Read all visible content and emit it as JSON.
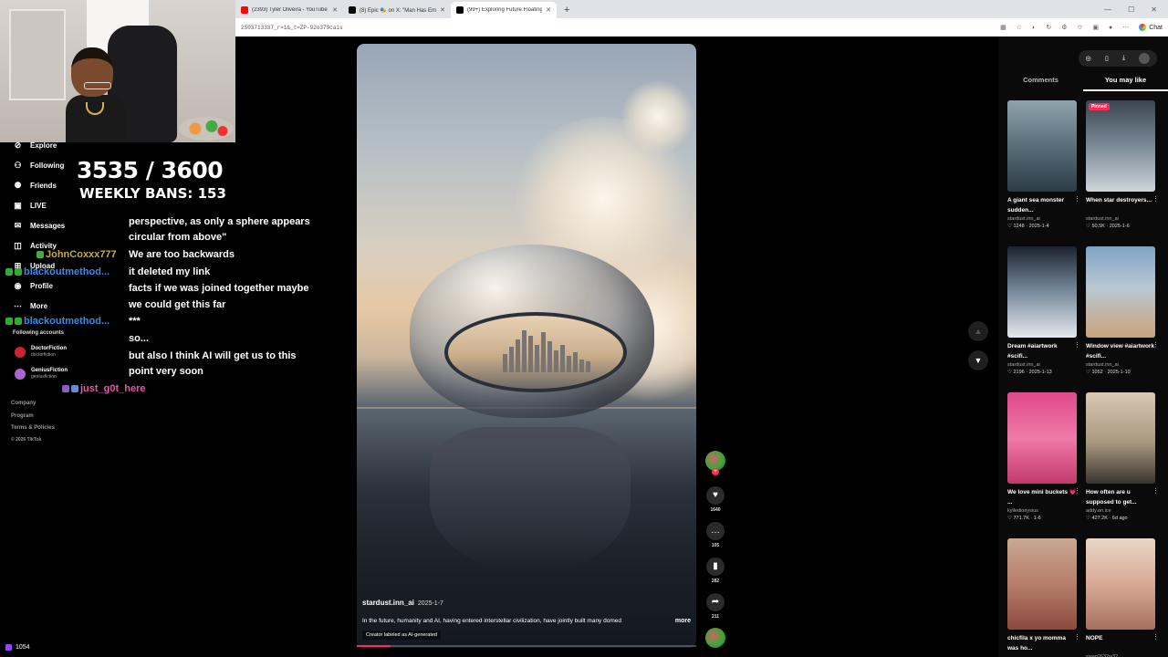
{
  "browser": {
    "tabs": [
      {
        "title": "(2393) Tyler Oliveira - YouTube",
        "icon_color": "#ff0000"
      },
      {
        "title": "(8) Epic 🎭 on X: \"Man Has Emoti...",
        "icon_color": "#000000"
      },
      {
        "title": "(99+) Exploring Future Floating Cit...",
        "icon_color": "#000000"
      }
    ],
    "url": "2503713337_r=1&_t=ZP-92o379cais",
    "chat_label": "Chat"
  },
  "sidebar": {
    "items": [
      {
        "label": "Explore",
        "icon": "compass-icon"
      },
      {
        "label": "Following",
        "icon": "following-icon"
      },
      {
        "label": "Friends",
        "icon": "friends-icon"
      },
      {
        "label": "LIVE",
        "icon": "live-icon"
      },
      {
        "label": "Messages",
        "icon": "messages-icon"
      },
      {
        "label": "Activity",
        "icon": "activity-icon"
      },
      {
        "label": "Upload",
        "icon": "upload-icon"
      },
      {
        "label": "Profile",
        "icon": "profile-icon"
      },
      {
        "label": "More",
        "icon": "more-icon"
      }
    ],
    "following_header": "Following accounts",
    "accounts": [
      {
        "name": "DoctorFiction",
        "handle": "doctorfiction",
        "color": "#c23"
      },
      {
        "name": "GeniusFiction",
        "handle": "geniusfiction",
        "color": "#a6c"
      }
    ],
    "footer": [
      "Company",
      "Program",
      "Terms & Policies"
    ],
    "copyright": "© 2026 TikTok"
  },
  "overlay": {
    "counter": "3535 / 3600",
    "weekly_bans": "WEEKLY BANS: 153"
  },
  "chat": [
    {
      "user": "",
      "text": "perspective, as only a sphere appears",
      "color": "#ffffff"
    },
    {
      "user": "",
      "text": "circular from above\"",
      "color": "#ffffff"
    },
    {
      "user": "JohnCoxxx777",
      "text": "We are too backwards",
      "color": "#c8a94a"
    },
    {
      "user": "blackoutmethod...",
      "text": "it deleted my link",
      "color": "#3a8be8"
    },
    {
      "user": "",
      "text": "facts if we was joined together maybe",
      "color": "#ffffff"
    },
    {
      "user": "",
      "text": "we could get this far",
      "color": "#ffffff"
    },
    {
      "user": "blackoutmethod...",
      "text": "***",
      "color": "#3a8be8"
    },
    {
      "user": "",
      "text": "so...",
      "color": "#ffffff"
    },
    {
      "user": "",
      "text": "but also I think AI will get us to this",
      "color": "#ffffff"
    },
    {
      "user": "",
      "text": "point very soon",
      "color": "#ffffff"
    },
    {
      "user": "just_g0t_here",
      "text": "",
      "color": "#e05aa8"
    }
  ],
  "video": {
    "author": "stardust.inn_ai",
    "date": "2025-1-7",
    "description": "In the future, humanity and AI, having entered interstellar civilization, have jointly built many domed",
    "more": "more",
    "label": "Creator labeled as AI-generated",
    "progress_fraction": 0.1
  },
  "actions": {
    "likes": "1640",
    "comments": "105",
    "saves": "282",
    "shares": "211"
  },
  "right_panel": {
    "tabs": [
      "Comments",
      "You may like"
    ],
    "active_tab": "You may like",
    "pinned_label": "Pinned",
    "cards": [
      {
        "title": "A giant sea monster sudden...",
        "author": "stardust.inn_ai",
        "likes": "1248",
        "date": "2025-1-4",
        "pinned": false,
        "bg": "linear-gradient(180deg,#8fa3ad,#4f6470 60%,#2d3b44)"
      },
      {
        "title": "When star destroyers...",
        "author": "stardust.inn_ai",
        "likes": "50.5K",
        "date": "2025-1-6",
        "pinned": true,
        "bg": "linear-gradient(180deg,#3a4450,#7b8a97 50%,#cfd5da)"
      },
      {
        "title": "Dream #aiartwork #scifi...",
        "author": "stardust.inn_ai",
        "likes": "2196",
        "date": "2025-1-13",
        "pinned": false,
        "bg": "linear-gradient(180deg,#1b2230,#6f8194 45%,#e2e8ee)"
      },
      {
        "title": "Window view #aiartwork #scifi...",
        "author": "stardust.inn_ai",
        "likes": "1052",
        "date": "2025-1-10",
        "pinned": false,
        "bg": "linear-gradient(180deg,#7fa3c4,#b8c7d2 45%,#c9a47c)"
      },
      {
        "title": "We love mini buckets 💗 ...",
        "author": "kylledionysius",
        "likes": "771.7K",
        "date": "1-6",
        "pinned": false,
        "bg": "linear-gradient(180deg,#e04a8a,#f07aa8 50%,#c23a6e)"
      },
      {
        "title": "How often are u supposed to get...",
        "author": "addy.on.ice",
        "likes": "427.2K",
        "date": "6d ago",
        "pinned": false,
        "bg": "linear-gradient(180deg,#d9c9b4,#a89880 55%,#3a3530)"
      },
      {
        "title": "chicfila x yo momma was ho...",
        "author": "",
        "likes": "",
        "date": "",
        "pinned": false,
        "bg": "linear-gradient(180deg,#c9a894,#b77e6a 50%,#8a4a3e)"
      },
      {
        "title": "NOPE",
        "author": "swag2632w32",
        "likes": "",
        "date": "",
        "pinned": false,
        "bg": "linear-gradient(180deg,#e8d7c8,#d8a994 50%,#a67260)"
      }
    ]
  },
  "stream": {
    "viewers": "1054"
  }
}
